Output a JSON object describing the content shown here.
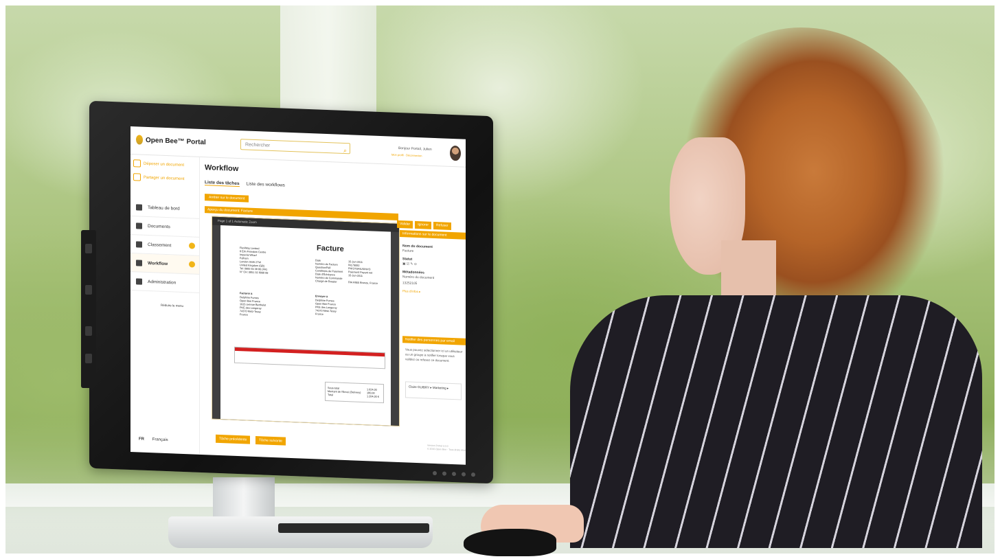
{
  "app": {
    "name": "Open Bee™ Portal",
    "search_placeholder": "Rechercher",
    "greeting": "Bonjour Portail, Julien",
    "greeting_links": "Mon profil · Déconnexion"
  },
  "sidebar": {
    "actions": [
      {
        "label": "Déposer un document",
        "icon": "upload-icon"
      },
      {
        "label": "Partager un document",
        "icon": "share-icon"
      }
    ],
    "items": [
      {
        "label": "Tableau de bord",
        "icon": "dashboard-icon",
        "badge": ""
      },
      {
        "label": "Documents",
        "icon": "folder-icon",
        "badge": ""
      },
      {
        "label": "Classement",
        "icon": "archive-icon",
        "badge": "0"
      },
      {
        "label": "Workflow",
        "icon": "checklist-icon",
        "badge": "0"
      },
      {
        "label": "Administration",
        "icon": "gear-icon",
        "badge": ""
      }
    ],
    "reduce_menu": "Réduire le menu",
    "language_code": "FR",
    "language_name": "Français"
  },
  "main": {
    "title": "Workflow",
    "tabs": [
      {
        "label": "Liste des tâches",
        "active": true
      },
      {
        "label": "Liste des workflows",
        "active": false
      }
    ],
    "filter_chip": "Arrêter sur le document",
    "preview_header": "Aperçu du document: Facture",
    "viewer_toolbar": "Page  1  of 1     Automatic Zoom",
    "invoice": {
      "title": "Facture",
      "sender": "FlexiMay Limited\n8 Elm Freedom Centre\nImperial Wharf\nFulham\nLondon SW6 2TW\nUnited Kingdom (GB)\nTel: 0800 84 38 86 (FR)\nN° CH: 0851 32 8998 89",
      "details": "Date\nNuméro de Facture\nQuestion/Réf.\nConditions de Paiement\nDate d'Échéance\nNuméro de Commande\nChargé de Dossier",
      "details_values": "15-Jun-2011\nIN179082\nPHISTORIUSINVO\nPaiement Payant net\n15-Jun-2011\n\nDIA RIEE Bronze, France",
      "billed_label": "Facturer à",
      "billed": "Delphine Fumes\nOpen Bee France\n1915 avenue Berthelot\nPKE des Longeray\n74370 Metz-Tessy\nFrance",
      "ship_label": "Envoyer à",
      "ship": "Delphine Fumes\nOpen Bee France\nPKE des Longeray\n74370 Metz-Tessy\nFrance",
      "total_text": "Sous-total\nMontant de l'Envoi (Delivery)\nTotal",
      "total_values": "1.024,00\n180,00\n1.204,00 €"
    },
    "actions": [
      "Valider",
      "Ignorer",
      "Refuser"
    ],
    "info_header": "Informations sur le document",
    "info": [
      {
        "label": "Nom du document",
        "value": "Facture"
      },
      {
        "label": "Statut",
        "value": ""
      },
      {
        "label": "Métadonnées",
        "value": "Numéro du document"
      },
      {
        "label": "",
        "value": "13252105"
      }
    ],
    "info_link": "Plus d'infos ▸",
    "notify_header": "Notifier des personnes par email",
    "notify_text": "Vous pouvez sélectionner ici un utilisateur ou un groupe à notifier lorsque vous validez ou refusez ce document.",
    "notify_users": "Claire GUIBRY ▸   Marketing ▸",
    "prev_task": "Tâche précédente",
    "next_task": "Tâche suivante",
    "footer": "Version Portal 2.0.0\n© 2015 Open Bee - Tous droits réservés"
  },
  "colors": {
    "accent": "#f1a500",
    "invoice_header": "#d32020"
  }
}
